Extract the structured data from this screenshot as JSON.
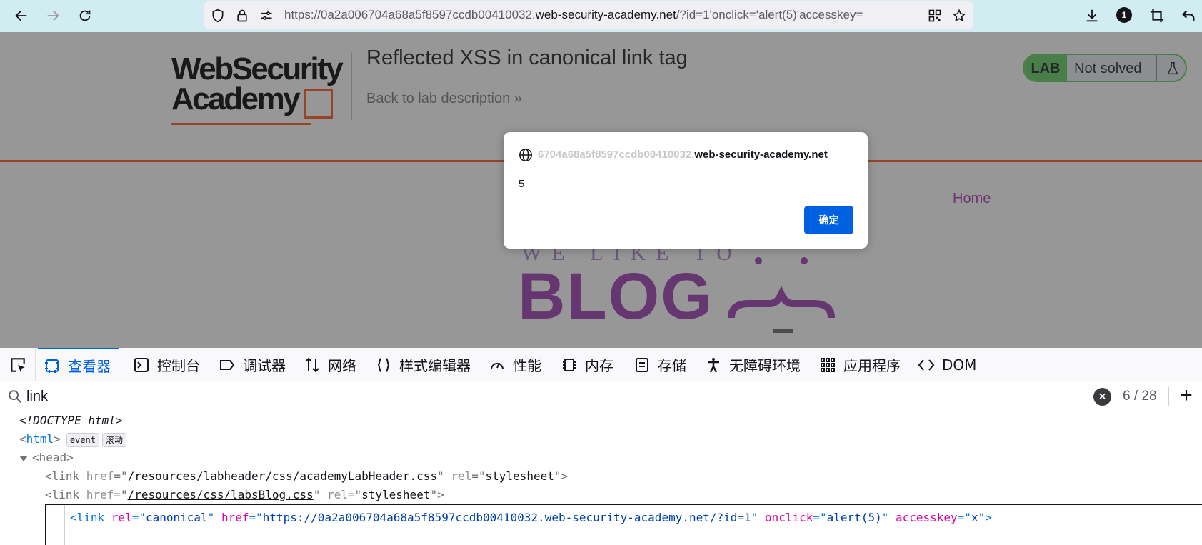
{
  "browser": {
    "url_prefix": "https://0a2a006704a68a5f8597ccdb00410032.",
    "url_domain": "web-security-academy.net",
    "url_suffix": "/?id=1'onclick='alert(5)'accesskey=",
    "notification_count": "1"
  },
  "page": {
    "logo_line1": "WebSecurity",
    "logo_line2": "Academy",
    "lab_title": "Reflected XSS in canonical link tag",
    "back_link": "Back to lab description",
    "back_chevron": "»",
    "lab_tag": "LAB",
    "lab_status": "Not solved",
    "nav_home": "Home",
    "blog_tagline": "WE LIKE TO",
    "blog_word": "BLOG"
  },
  "dialog": {
    "origin_faded": "6704a68a5f8597ccdb00410032.",
    "origin_rest": "web-security-academy.net",
    "origin_lead": "",
    "message": "5",
    "ok_label": "确定"
  },
  "devtools": {
    "tabs": [
      {
        "label": "查看器",
        "icon": "inspector-icon"
      },
      {
        "label": "控制台",
        "icon": "console-icon"
      },
      {
        "label": "调试器",
        "icon": "debugger-icon"
      },
      {
        "label": "网络",
        "icon": "network-icon"
      },
      {
        "label": "样式编辑器",
        "icon": "style-editor-icon"
      },
      {
        "label": "性能",
        "icon": "performance-icon"
      },
      {
        "label": "内存",
        "icon": "memory-icon"
      },
      {
        "label": "存储",
        "icon": "storage-icon"
      },
      {
        "label": "无障碍环境",
        "icon": "accessibility-icon"
      },
      {
        "label": "应用程序",
        "icon": "application-icon"
      },
      {
        "label": "DOM",
        "icon": "dom-icon"
      }
    ],
    "search_value": "link",
    "search_count": "6 / 28",
    "markup": {
      "doctype": "<!DOCTYPE html>",
      "html_open": "<",
      "html_name": "html",
      "html_close": ">",
      "badge_event": "event",
      "badge_scroll": "滚动",
      "head_text": "<head>",
      "link1_href": "/resources/labheader/css/academyLabHeader.css",
      "link1_rel": "stylesheet",
      "link2_href": "/resources/css/labsBlog.css",
      "link2_rel": "stylesheet",
      "link3_rel": "canonical",
      "link3_href": "https://0a2a006704a68a5f8597ccdb00410032.web-security-academy.net/?id=1",
      "link3_onclick": "alert(5)",
      "link3_accesskey": "x"
    }
  }
}
